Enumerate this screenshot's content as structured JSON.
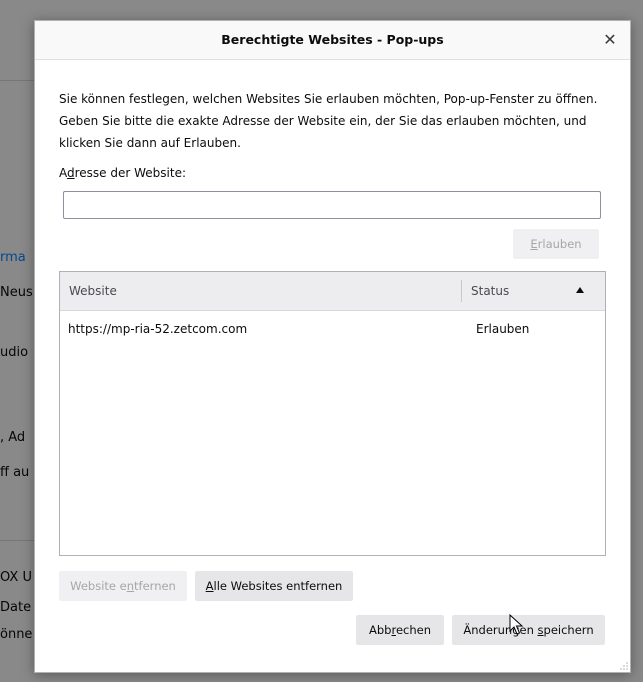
{
  "background": {
    "lines": [
      {
        "text": "rma",
        "link": true
      },
      {
        "text": "Neus",
        "link": false
      },
      {
        "text": "udio",
        "link": false
      },
      {
        "text": ", Ad",
        "link": false
      },
      {
        "text": "ff au",
        "link": false
      },
      {
        "text": "OX U",
        "link": false
      },
      {
        "text": "Date",
        "link": false
      },
      {
        "text": "önne",
        "link": false
      }
    ]
  },
  "dialog": {
    "title": "Berechtigte Websites - Pop-ups",
    "close_icon": "close-icon",
    "description": "Sie können festlegen, welchen Websites Sie erlauben möchten, Pop-up-Fenster zu öffnen. Geben Sie bitte die exakte Adresse der Website ein, der Sie das erlauben möchten, und klicken Sie dann auf Erlauben.",
    "address_label_pre": "A",
    "address_label_key": "d",
    "address_label_post": "resse der Website:",
    "address_value": "",
    "allow_button_key": "E",
    "allow_button_rest": "rlauben",
    "table": {
      "columns": [
        "Website",
        "Status"
      ],
      "sort_icon": "sort-ascending-icon",
      "rows": [
        {
          "website": "https://mp-ria-52.zetcom.com",
          "status": "Erlauben"
        }
      ]
    },
    "remove_site_pre": "Website e",
    "remove_site_key": "n",
    "remove_site_post": "tfernen",
    "remove_all_key": "A",
    "remove_all_post": "lle Websites entfernen",
    "cancel_pre": "Abb",
    "cancel_key": "r",
    "cancel_post": "echen",
    "save_pre": "Änderungen ",
    "save_key": "s",
    "save_post": "peichern"
  }
}
